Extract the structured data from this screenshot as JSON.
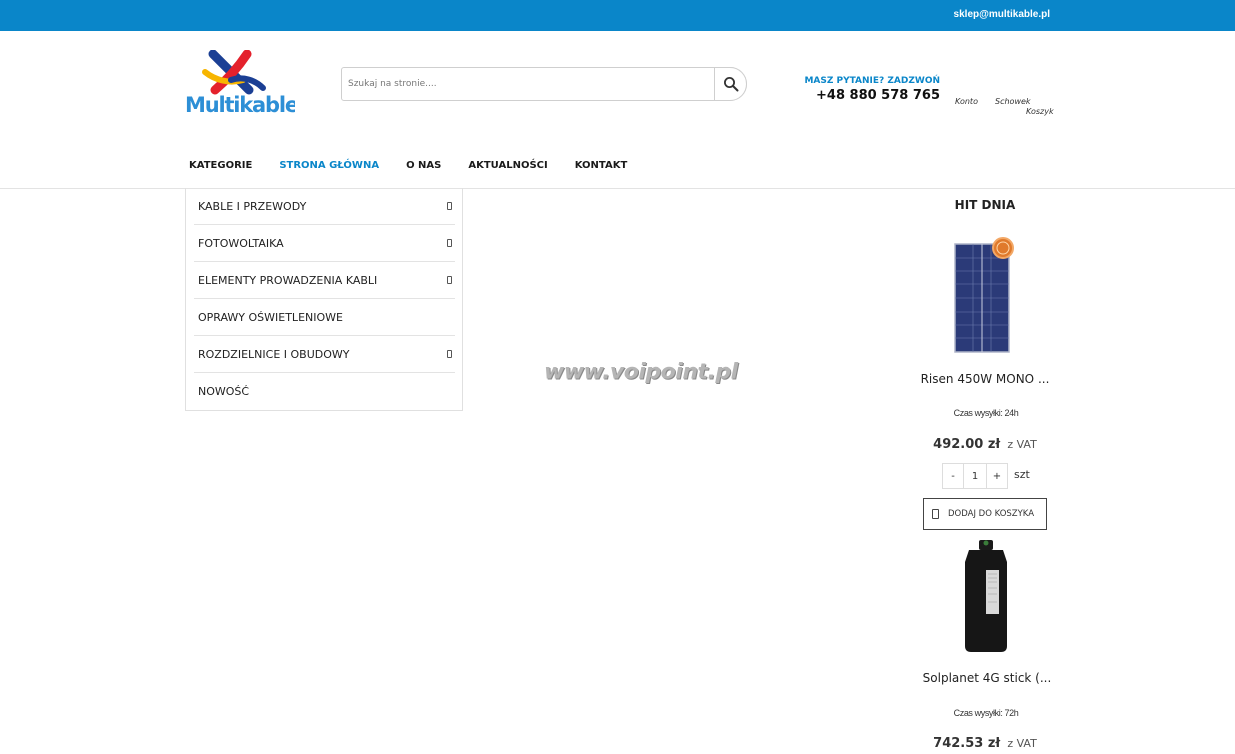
{
  "topbar": {
    "email": "sklep@multikable.pl",
    "bg_color": "#0a86c9"
  },
  "logo": {
    "text": "Multikable"
  },
  "search": {
    "placeholder": "Szukaj na stronie....",
    "icon": "search-icon"
  },
  "contact": {
    "question": "MASZ PYTANIE? ZADZWOŃ",
    "phone": "+48 880 578 765"
  },
  "account": {
    "konto": "Konto",
    "schowek": "Schowek",
    "koszyk": "Koszyk"
  },
  "nav": {
    "items": [
      {
        "label": "KATEGORIE"
      },
      {
        "label": "STRONA GŁÓWNA",
        "active": true
      },
      {
        "label": "O NAS"
      },
      {
        "label": "AKTUALNOŚCI"
      },
      {
        "label": "KONTAKT"
      }
    ]
  },
  "categories": [
    {
      "label": "KABLE I PRZEWODY",
      "has_sub": true
    },
    {
      "label": "FOTOWOLTAIKA",
      "has_sub": true
    },
    {
      "label": "ELEMENTY PROWADZENIA KABLI",
      "has_sub": true
    },
    {
      "label": "OPRAWY OŚWIETLENIOWE",
      "has_sub": false
    },
    {
      "label": "ROZDZIELNICE I OBUDOWY",
      "has_sub": true
    },
    {
      "label": "NOWOŚĆ",
      "has_sub": false
    }
  ],
  "banner": {
    "watermark": "www.voipoint.pl"
  },
  "hit": {
    "title": "HIT DNIA",
    "products": [
      {
        "name": "Risen 450W MONO ...",
        "shipping": "Czas wysyłki: 24h",
        "price": "492.00 zł",
        "vat": "z VAT",
        "qty": "1",
        "unit": "szt",
        "minus": "-",
        "plus": "+",
        "add_label": "DODAJ DO KOSZYKA",
        "image": "solar-panel"
      },
      {
        "name": "Solplanet 4G stick (...",
        "shipping": "Czas wysyłki: 72h",
        "price": "742.53 zł",
        "vat": "z VAT",
        "image": "4g-stick"
      }
    ]
  },
  "colors": {
    "accent": "#0a86c9"
  }
}
